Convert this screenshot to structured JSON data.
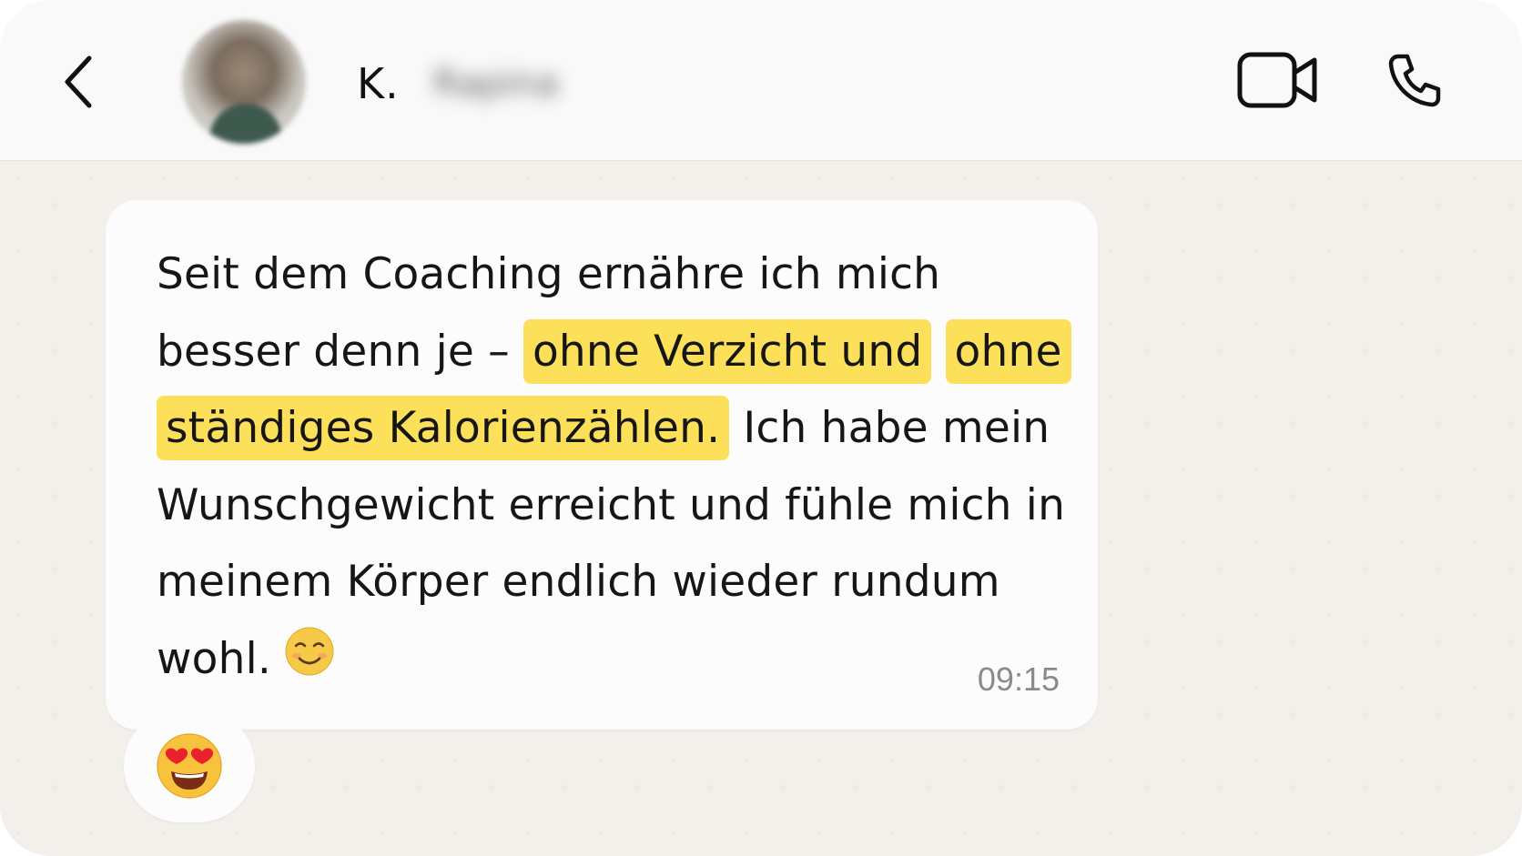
{
  "header": {
    "contact_initial": "K.",
    "contact_surname": "Rapina",
    "icons": {
      "back": "chevron-left-icon",
      "video": "video-camera-icon",
      "phone": "phone-icon"
    }
  },
  "message": {
    "text_before": "Seit dem Coaching ernähre ich mich besser denn je – ",
    "highlight_1": "ohne Verzicht und",
    "highlight_2": "ohne ständiges Kalorienzählen.",
    "text_after": " Ich habe mein Wunschgewicht erreicht und fühle mich in meinem Körper endlich wieder rundum wohl.",
    "emoji": "smiling-face-icon",
    "time": "09:15",
    "highlight_color": "#fde05a"
  },
  "reaction": {
    "emoji": "heart-eyes-icon"
  },
  "colors": {
    "header_bg": "#f9f9f9",
    "chat_bg": "#f3f0eb",
    "bubble_bg": "#fcfcfc",
    "text": "#161616",
    "time": "#8a8a8a"
  }
}
